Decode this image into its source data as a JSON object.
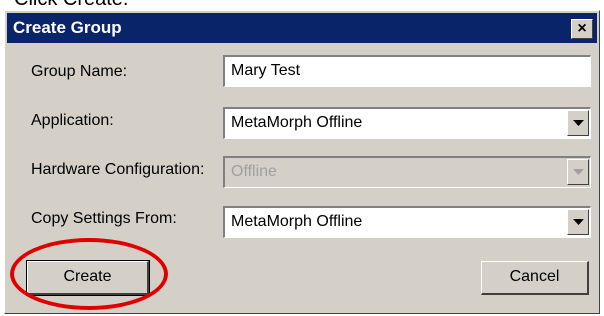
{
  "caption": "Click Create.",
  "dialog": {
    "title": "Create Group",
    "close_glyph": "×",
    "fields": {
      "group_name": {
        "label": "Group Name:",
        "value": "Mary Test"
      },
      "application": {
        "label": "Application:",
        "value": "MetaMorph Offline"
      },
      "hardware": {
        "label": "Hardware Configuration:",
        "value": "Offline",
        "disabled": true
      },
      "copy_settings": {
        "label": "Copy Settings From:",
        "value": "MetaMorph Offline"
      }
    },
    "buttons": {
      "create": "Create",
      "cancel": "Cancel"
    }
  },
  "annotation": {
    "highlight_color": "#e00000",
    "target": "create-button"
  },
  "icons": {
    "dropdown": "chevron-down-icon",
    "close": "close-icon"
  }
}
